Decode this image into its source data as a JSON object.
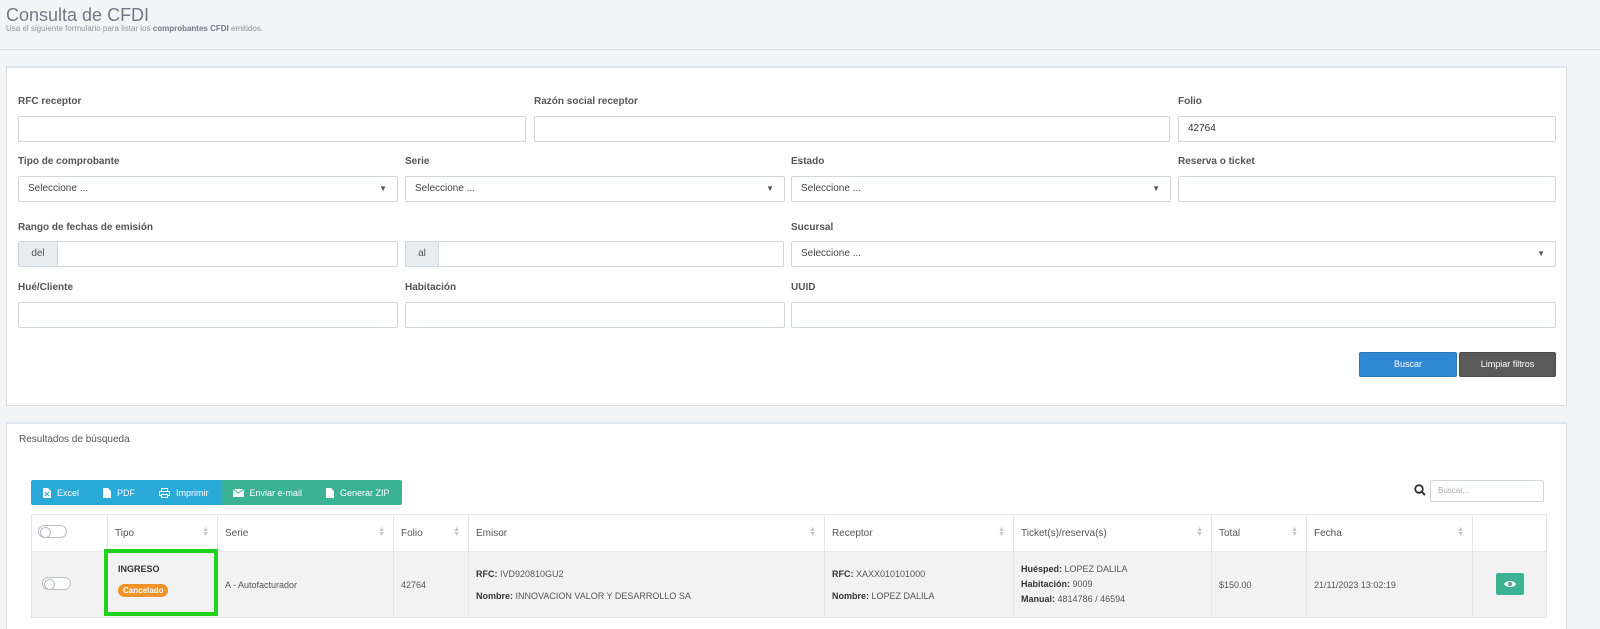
{
  "header": {
    "title": "Consulta de CFDI",
    "subtitle_pre": "Usa el siguiente formulario para listar los",
    "subtitle_bold": "comprobantes CFDI",
    "subtitle_post": "emitidos."
  },
  "filters": {
    "rfc_receptor": {
      "label": "RFC receptor",
      "value": ""
    },
    "razon_social": {
      "label": "Razón social receptor",
      "value": ""
    },
    "folio": {
      "label": "Folio",
      "value": "42764"
    },
    "tipo_comprobante": {
      "label": "Tipo de comprobante",
      "value": "Seleccione ..."
    },
    "serie": {
      "label": "Serie",
      "value": "Seleccione ..."
    },
    "estado": {
      "label": "Estado",
      "value": "Seleccione ..."
    },
    "reserva": {
      "label": "Reserva o ticket",
      "value": ""
    },
    "rango_fechas": {
      "label": "Rango de fechas de emisión",
      "del": "del",
      "al": "al"
    },
    "sucursal": {
      "label": "Sucursal",
      "value": "Seleccione ..."
    },
    "huesped": {
      "label": "Hué/Cliente",
      "value": ""
    },
    "habitacion": {
      "label": "Habitación",
      "value": ""
    },
    "uuid": {
      "label": "UUID",
      "value": ""
    },
    "buscar": "Buscar",
    "limpiar": "Limpiar filtros"
  },
  "results": {
    "title": "Resultados de búsqueda",
    "toolbar": {
      "excel": "Excel",
      "pdf": "PDF",
      "imprimir": "Imprimir",
      "email": "Enviar e-mail",
      "zip": "Generar ZIP"
    },
    "search_placeholder": "Buscar...",
    "columns": {
      "tipo": "Tipo",
      "serie": "Serie",
      "folio": "Folio",
      "emisor": "Emisor",
      "receptor": "Receptor",
      "tickets": "Ticket(s)/reserva(s)",
      "total": "Total",
      "fecha": "Fecha"
    },
    "row": {
      "tipo": "INGRESO",
      "estado": "Cancelado",
      "serie": "A - Autofacturador",
      "folio": "42764",
      "emisor_rfc_label": "RFC:",
      "emisor_rfc": "IVD920810GU2",
      "emisor_nombre_label": "Nombre:",
      "emisor_nombre": "INNOVACION VALOR Y DESARROLLO SA",
      "receptor_rfc_label": "RFC:",
      "receptor_rfc": "XAXX010101000",
      "receptor_nombre_label": "Nombre:",
      "receptor_nombre": "LOPEZ DALILA",
      "huesped_label": "Huésped:",
      "huesped": "LOPEZ DALILA",
      "habitacion_label": "Habitación:",
      "habitacion": "9009",
      "manual_label": "Manual:",
      "manual": "4814786 / 46594",
      "total": "$150.00",
      "fecha": "21/11/2023 13:02:19"
    }
  },
  "colors": {
    "primary": "#3087d3",
    "dark": "#5a5a5a",
    "info": "#29a9d8",
    "success": "#3ab293",
    "warning": "#f0932b",
    "highlight": "#1ed21e"
  }
}
